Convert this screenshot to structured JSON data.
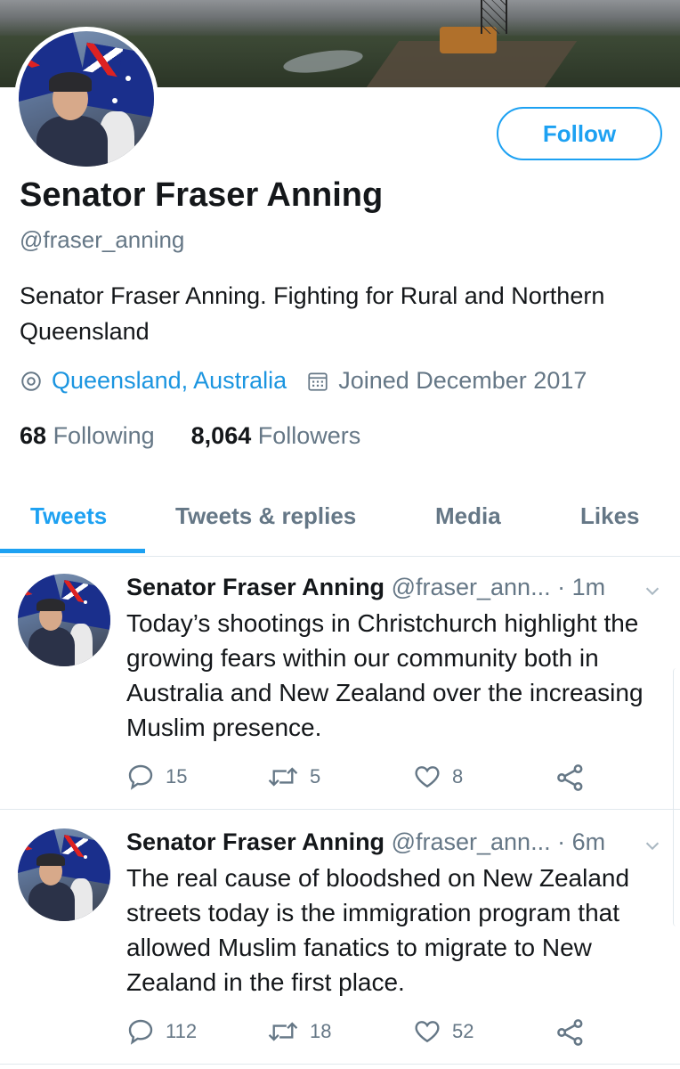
{
  "profile": {
    "name": "Senator Fraser Anning",
    "handle": "@fraser_anning",
    "bio": "Senator Fraser Anning. Fighting for Rural and Northern Queensland",
    "location": "Queensland, Australia",
    "joined": "Joined December 2017",
    "following_count": "68",
    "following_label": "Following",
    "followers_count": "8,064",
    "followers_label": "Followers",
    "follow_button": "Follow"
  },
  "tabs": [
    "Tweets",
    "Tweets & replies",
    "Media",
    "Likes"
  ],
  "active_tab": "Tweets",
  "tweets": [
    {
      "name": "Senator Fraser Anning",
      "handle": "@fraser_ann...",
      "time": "· 1m",
      "text": "Today’s shootings in Christchurch highlight the growing fears within our community both in Australia and New Zealand over the increasing Muslim presence.",
      "replies": "15",
      "retweets": "5",
      "likes": "8"
    },
    {
      "name": "Senator Fraser Anning",
      "handle": "@fraser_ann...",
      "time": "· 6m",
      "text": "The real cause of bloodshed on New Zealand streets today is the immigration program that allowed Muslim fanatics to migrate to New Zealand in the first place.",
      "replies": "112",
      "retweets": "18",
      "likes": "52"
    }
  ],
  "icons": {
    "location": "location-pin-icon",
    "calendar": "calendar-icon",
    "reply": "reply-icon",
    "retweet": "retweet-icon",
    "like": "heart-icon",
    "share": "share-icon",
    "caret": "chevron-down-icon"
  },
  "colors": {
    "accent": "#1da1f2",
    "link": "#1b95e0",
    "secondary_text": "#657786",
    "primary_text": "#14171a",
    "divider": "#e1e8ed"
  }
}
